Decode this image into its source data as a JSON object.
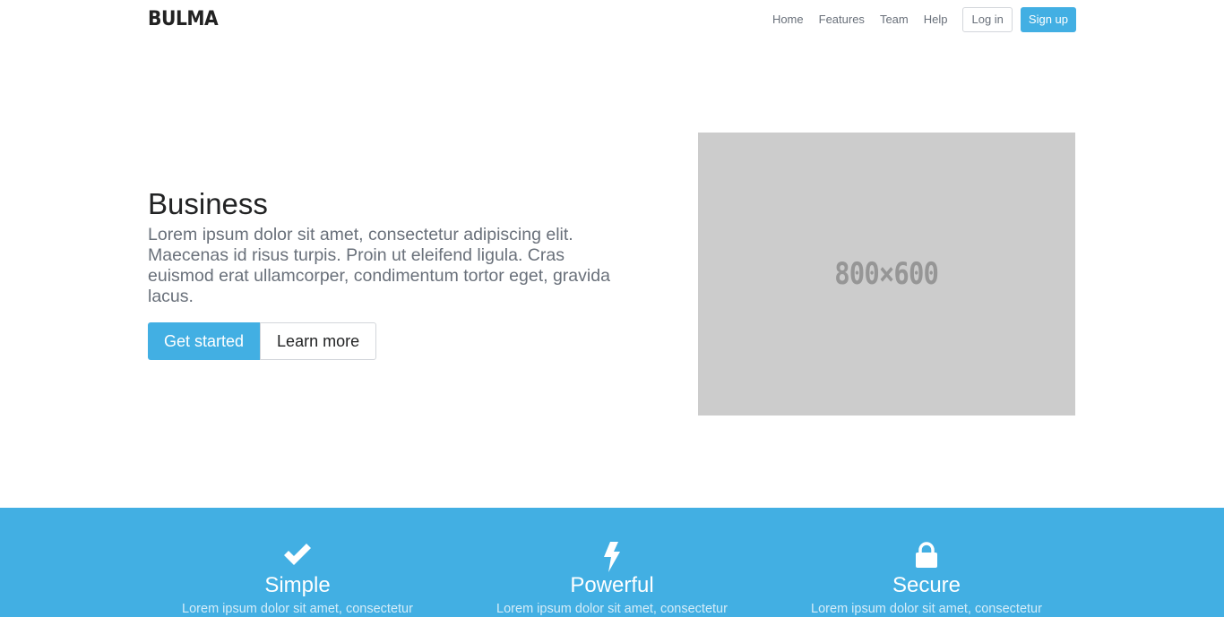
{
  "navbar": {
    "logo": "BULMA",
    "links": [
      "Home",
      "Features",
      "Team",
      "Help"
    ],
    "login_label": "Log in",
    "signup_label": "Sign up"
  },
  "hero": {
    "title": "Business",
    "subtitle": "Lorem ipsum dolor sit amet, consectetur adipiscing elit. Maecenas id risus turpis. Proin ut eleifend ligula. Cras euismod erat ullamcorper, condimentum tortor eget, gravida lacus.",
    "primary_button": "Get started",
    "secondary_button": "Learn more",
    "image_label": "800×600"
  },
  "features": [
    {
      "icon": "check-icon",
      "title": "Simple",
      "text": "Lorem ipsum dolor sit amet, consectetur"
    },
    {
      "icon": "bolt-icon",
      "title": "Powerful",
      "text": "Lorem ipsum dolor sit amet, consectetur"
    },
    {
      "icon": "lock-icon",
      "title": "Secure",
      "text": "Lorem ipsum dolor sit amet, consectetur"
    }
  ],
  "colors": {
    "accent": "#42afe3",
    "placeholder_bg": "#cccccc",
    "heading": "#222324",
    "body_text": "#69707a"
  }
}
